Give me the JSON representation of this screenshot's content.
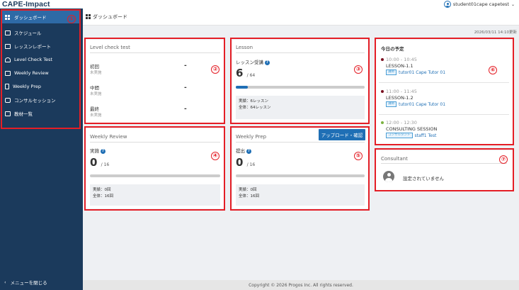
{
  "app": {
    "brand": "CAPE-Impact",
    "user": "student01cape capetest"
  },
  "sidebar": {
    "items": [
      {
        "label": "ダッシュボード",
        "icon": "dashboard-icon",
        "active": true
      },
      {
        "label": "スケジュール",
        "icon": "calendar-icon"
      },
      {
        "label": "レッスンレポート",
        "icon": "report-icon"
      },
      {
        "label": "Level Check Test",
        "icon": "test-icon"
      },
      {
        "label": "Weekly Review",
        "icon": "review-icon"
      },
      {
        "label": "Weekly Prep",
        "icon": "document-icon"
      },
      {
        "label": "コンサルセッション",
        "icon": "chat-icon"
      },
      {
        "label": "教材一覧",
        "icon": "materials-icon"
      }
    ],
    "close_menu": "メニューを閉じる",
    "close_arrow": "‹"
  },
  "header": {
    "title": "ダッシュボード",
    "timestamp": "2026/03/11 14:10更新"
  },
  "annotations": [
    "①",
    "②",
    "③",
    "④",
    "⑤",
    "⑥",
    "⑦"
  ],
  "level_check": {
    "title": "Level check test",
    "rows": [
      {
        "label": "初回",
        "status": "未実施",
        "value": "-"
      },
      {
        "label": "中間",
        "status": "未実施",
        "value": "-"
      },
      {
        "label": "最終",
        "status": "未実施",
        "value": "-"
      }
    ]
  },
  "lesson": {
    "title": "Lesson",
    "label": "レッスン受講",
    "help": "?",
    "count": "6",
    "total": "/ 64",
    "progress": 0.094,
    "summary_done": "実績：6レッスン",
    "summary_total": "全体：64レッスン"
  },
  "weekly_review": {
    "title": "Weekly Review",
    "label": "実施",
    "help": "?",
    "count": "0",
    "total": "/ 16",
    "progress": 0,
    "summary_done": "実績：0回",
    "summary_total": "全体：16回"
  },
  "weekly_prep": {
    "title": "Weekly Prep",
    "button": "アップロード・確認",
    "label": "提出",
    "help": "?",
    "count": "0",
    "total": "/ 16",
    "progress": 0,
    "summary_done": "実績：0回",
    "summary_total": "全体：16回"
  },
  "schedule": {
    "title": "今日の予定",
    "events": [
      {
        "time": "10:00 - 10:45",
        "name": "LESSON-1.1",
        "badge": "講師",
        "person": "tutor01 Cape Tutor 01",
        "dot_color": "#7a1020"
      },
      {
        "time": "11:00 - 11:45",
        "name": "LESSON-1.2",
        "badge": "講師",
        "person": "tutor01 Cape Tutor 01",
        "dot_color": "#7a1020"
      },
      {
        "time": "12:00 - 12:30",
        "name": "CONSULTING SESSION",
        "badge": "コンサルタント",
        "person": "staff1 Test",
        "dot_color": "#7cb342"
      }
    ]
  },
  "consultant": {
    "title": "Consultant",
    "empty": "設定されていません"
  },
  "footer": {
    "copyright": "Copyright © 2026 Progos Inc. All rights reserved."
  }
}
